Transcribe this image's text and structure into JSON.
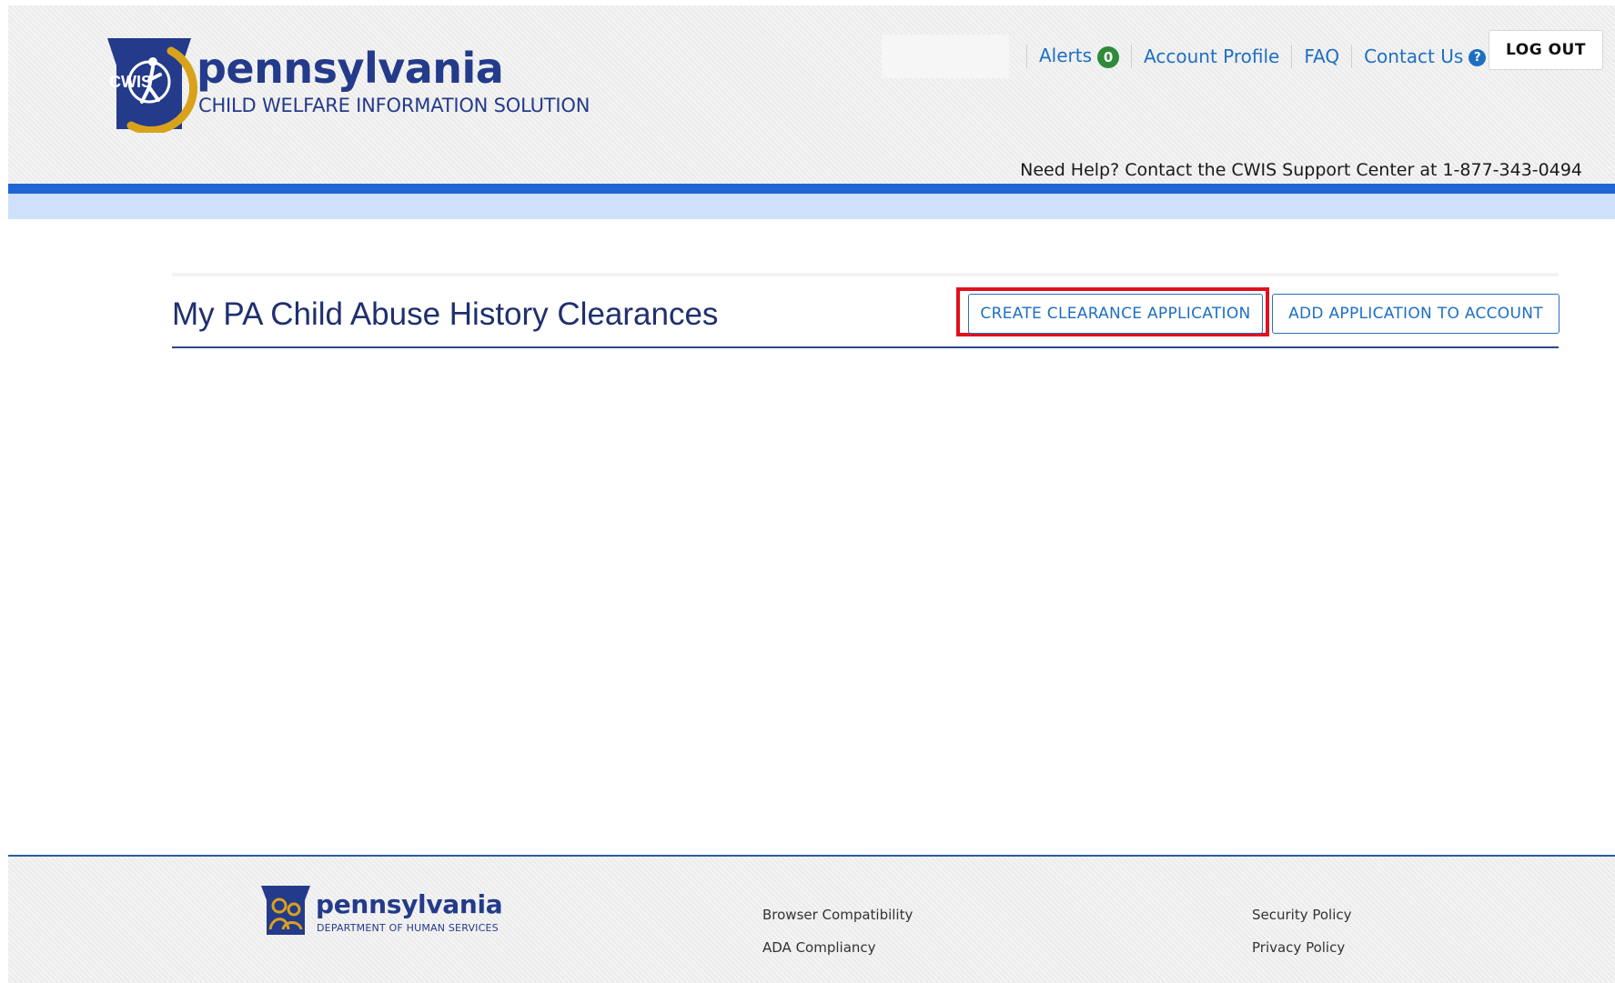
{
  "header": {
    "brand_name": "pennsylvania",
    "brand_subtitle": "CHILD WELFARE INFORMATION SOLUTION",
    "logo_text": "CWIS",
    "nav": {
      "alerts_label": "Alerts",
      "alerts_count": "0",
      "account_profile_label": "Account Profile",
      "faq_label": "FAQ",
      "contact_us_label": "Contact Us",
      "contact_us_badge": "?",
      "logout_label": "LOG OUT"
    },
    "help_text": "Need Help? Contact the CWIS Support Center at 1-877-343-0494"
  },
  "main": {
    "title": "My PA Child Abuse History Clearances",
    "create_button_label": "CREATE CLEARANCE APPLICATION",
    "add_button_label": "ADD APPLICATION TO ACCOUNT"
  },
  "footer": {
    "logo_name": "pennsylvania",
    "logo_subtitle": "DEPARTMENT OF HUMAN SERVICES",
    "links": {
      "browser_compatibility": "Browser Compatibility",
      "ada_compliancy": "ADA Compliancy",
      "security_policy": "Security Policy",
      "privacy_policy": "Privacy Policy"
    }
  },
  "colors": {
    "brand_navy": "#243a8a",
    "link_blue": "#1e6fc2",
    "header_bar_blue": "#2064d6",
    "highlight_red": "#e0101e",
    "alert_green": "#2e8b3a"
  }
}
